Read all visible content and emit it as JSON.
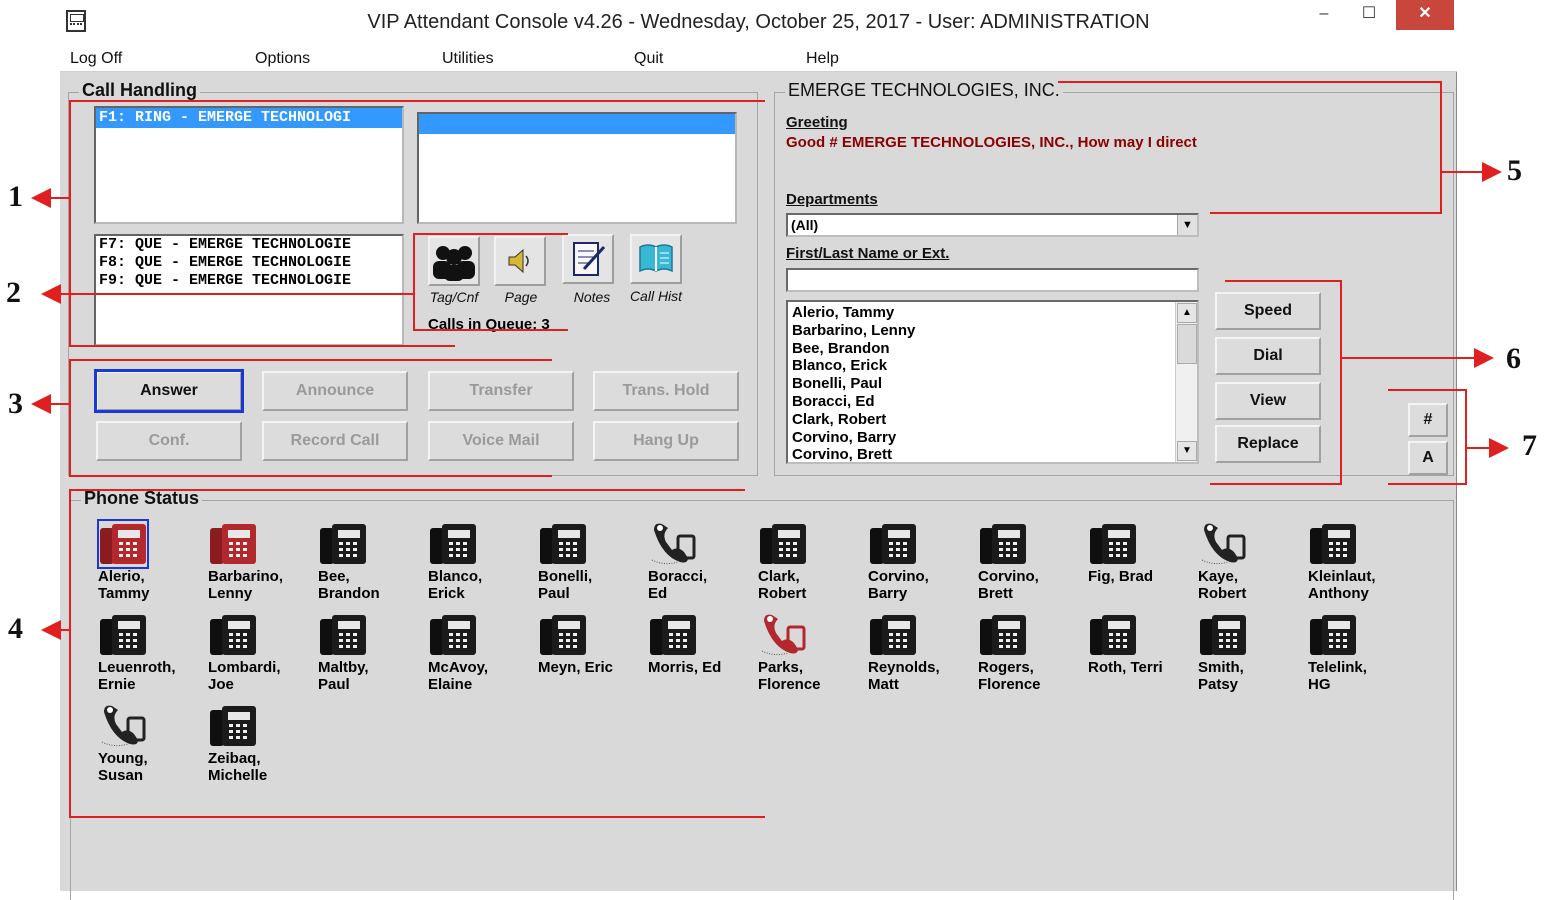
{
  "window": {
    "title": "VIP Attendant Console v4.26 - Wednesday, October 25, 2017 - User: ADMINISTRATION",
    "controls": {
      "minimize": "–",
      "maximize": "☐",
      "close": "✕"
    }
  },
  "menu": [
    "Log Off",
    "Options",
    "Utilities",
    "Quit",
    "Help"
  ],
  "call_handling": {
    "label": "Call Handling",
    "active_calls": [
      "F1: RING - EMERGE TECHNOLOGI"
    ],
    "queue_calls": [
      "F7: QUE - EMERGE TECHNOLOGIE",
      "F8: QUE - EMERGE TECHNOLOGIE",
      "F9: QUE - EMERGE TECHNOLOGIE"
    ],
    "tools": [
      "Tag/Cnf",
      "Page",
      "Notes",
      "Call Hist"
    ],
    "calls_in_queue": "Calls in Queue: 3",
    "buttons_row1": [
      "Answer",
      "Announce",
      "Transfer",
      "Trans. Hold"
    ],
    "buttons_row2": [
      "Conf.",
      "Record Call",
      "Voice Mail",
      "Hang Up"
    ]
  },
  "company": {
    "label": "EMERGE TECHNOLOGIES, INC.",
    "greeting_label": "Greeting",
    "greeting_text": "Good # EMERGE TECHNOLOGIES, INC., How may I direct",
    "departments_label": "Departments",
    "departments_value": "(All)",
    "search_label": "First/Last Name or Ext.",
    "search_value": "",
    "directory": [
      "Alerio, Tammy",
      "Barbarino, Lenny",
      "Bee, Brandon",
      "Blanco, Erick",
      "Bonelli, Paul",
      "Boracci, Ed",
      "Clark, Robert",
      "Corvino, Barry",
      "Corvino, Brett"
    ],
    "side_buttons": [
      "Speed",
      "Dial",
      "View",
      "Replace"
    ],
    "index_buttons": [
      "#",
      "A"
    ]
  },
  "phone_status": {
    "label": "Phone Status",
    "phones": [
      {
        "name": "Alerio,\nTammy",
        "state": "ringing"
      },
      {
        "name": "Barbarino,\nLenny",
        "state": "ringing"
      },
      {
        "name": "Bee,\nBrandon",
        "state": "idle"
      },
      {
        "name": "Blanco,\nErick",
        "state": "idle"
      },
      {
        "name": "Bonelli,\nPaul",
        "state": "idle"
      },
      {
        "name": "Boracci,\nEd",
        "state": "offhook"
      },
      {
        "name": "Clark,\nRobert",
        "state": "idle"
      },
      {
        "name": "Corvino,\nBarry",
        "state": "idle"
      },
      {
        "name": "Corvino,\nBrett",
        "state": "idle"
      },
      {
        "name": "Fig, Brad",
        "state": "idle"
      },
      {
        "name": "Kaye,\nRobert",
        "state": "offhook"
      },
      {
        "name": "Kleinlaut,\nAnthony",
        "state": "idle"
      },
      {
        "name": "Leuenroth,\nErnie",
        "state": "idle"
      },
      {
        "name": "Lombardi,\nJoe",
        "state": "idle"
      },
      {
        "name": "Maltby,\nPaul",
        "state": "idle"
      },
      {
        "name": "McAvoy,\nElaine",
        "state": "idle"
      },
      {
        "name": "Meyn, Eric",
        "state": "idle"
      },
      {
        "name": "Morris, Ed",
        "state": "idle"
      },
      {
        "name": "Parks,\nFlorence",
        "state": "offhook-red"
      },
      {
        "name": "Reynolds,\nMatt",
        "state": "idle"
      },
      {
        "name": "Rogers,\nFlorence",
        "state": "idle"
      },
      {
        "name": "Roth, Terri",
        "state": "idle"
      },
      {
        "name": "Smith,\nPatsy",
        "state": "idle"
      },
      {
        "name": "Telelink,\nHG",
        "state": "idle"
      },
      {
        "name": "Young,\nSusan",
        "state": "offhook"
      },
      {
        "name": "Zeibaq,\nMichelle",
        "state": "idle"
      }
    ]
  },
  "annotations": [
    "1",
    "2",
    "3",
    "4",
    "5",
    "6",
    "7"
  ],
  "colors": {
    "annotation": "#e02020",
    "selection": "#3399ff",
    "greeting": "#8b0000",
    "focus": "#1a38d8"
  }
}
